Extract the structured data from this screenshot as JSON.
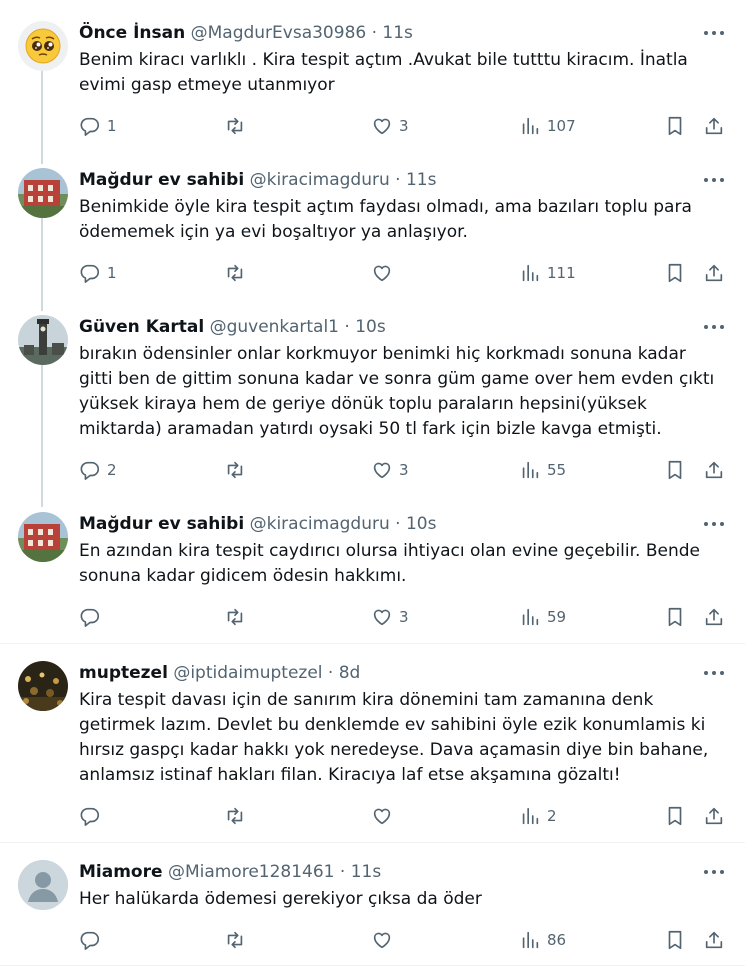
{
  "posts": [
    {
      "name": "Önce İnsan",
      "handle": "@MagdurEvsa30986",
      "time": "11s",
      "text": "Benim kiracı varlıklı . Kira tespit açtım .Avukat bile tutttu kiracım. İnatla evimi gasp etmeye utanmıyor",
      "replies": "1",
      "retweets": "",
      "likes": "3",
      "views": "107",
      "avatar": "emoji-pleading-face"
    },
    {
      "name": "Mağdur ev sahibi",
      "handle": "@kiracimagduru",
      "time": "11s",
      "text": "Benimkide öyle kira tespit açtım faydası olmadı, ama bazıları toplu para ödememek için ya evi boşaltıyor ya anlaşıyor.",
      "replies": "1",
      "retweets": "",
      "likes": "",
      "views": "111",
      "avatar": "photo-red-building"
    },
    {
      "name": "Güven Kartal",
      "handle": "@guvenkartal1",
      "time": "10s",
      "text": "bırakın ödensinler onlar korkmuyor benimki hiç korkmadı sonuna kadar gitti ben de gittim sonuna kadar ve sonra güm game over hem evden çıktı yüksek kiraya hem de geriye dönük toplu paraların hepsini(yüksek miktarda) aramadan yatırdı oysaki 50 tl fark için bizle kavga etmişti.",
      "replies": "2",
      "retweets": "",
      "likes": "3",
      "views": "55",
      "avatar": "photo-clock-tower"
    },
    {
      "name": "Mağdur ev sahibi",
      "handle": "@kiracimagduru",
      "time": "10s",
      "text": "En azından kira tespit caydırıcı olursa ihtiyacı olan evine geçebilir. Bende sonuna kadar gidicem ödesin hakkımı.",
      "replies": "",
      "retweets": "",
      "likes": "3",
      "views": "59",
      "avatar": "photo-red-building"
    },
    {
      "name": "muptezel",
      "handle": "@iptidaimuptezel",
      "time": "8d",
      "text": "Kira tespit davası için de sanırım kira dönemini tam zamanına denk getirmek lazım. Devlet bu denklemde ev  sahibini öyle ezik konumlamis ki hırsız gaspçı kadar hakkı yok neredeyse. Dava açamasin diye bin bahane, anlamsız istinaf hakları filan. Kiracıya laf etse akşamına gözaltı!",
      "replies": "",
      "retweets": "",
      "likes": "",
      "views": "2",
      "avatar": "photo-crowd-night"
    },
    {
      "name": "Miamore",
      "handle": "@Miamore1281461",
      "time": "11s",
      "text": "Her halükarda ödemesi gerekiyor çıksa da öder",
      "replies": "",
      "retweets": "",
      "likes": "",
      "views": "86",
      "avatar": "default-user-avatar"
    }
  ],
  "separator": "·",
  "colors": {
    "text": "#0f1419",
    "secondary": "#536471",
    "thread_line": "#cfd9de",
    "divider": "#eff3f4"
  }
}
